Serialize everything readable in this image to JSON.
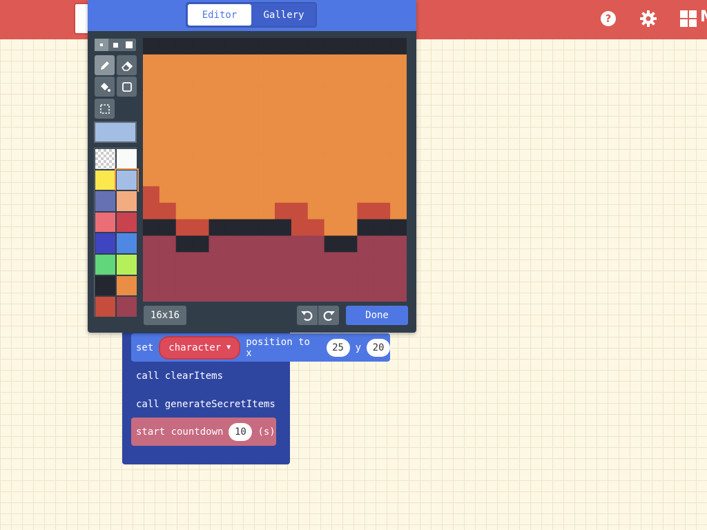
{
  "header": {
    "app_label": "M",
    "help_icon": "help-circle-icon",
    "settings_icon": "gear-icon",
    "logo_icon": "windows-logo-icon"
  },
  "editor": {
    "tabs": [
      {
        "label": "Editor",
        "active": true
      },
      {
        "label": "Gallery",
        "active": false
      }
    ],
    "brush_sizes": [
      "small",
      "medium",
      "large"
    ],
    "selected_brush": "small",
    "tools": [
      "pencil-icon",
      "eraser-icon",
      "fill-bucket-icon",
      "rectangle-icon",
      "marquee-select-icon"
    ],
    "selected_tool": "pencil-icon",
    "current_color": "#a4bde4",
    "palette": [
      "transparent",
      "#f8fbf8",
      "#fbe84f",
      "#a4bde4",
      "#6671b3",
      "#f3ab80",
      "#eb6e76",
      "#c9434f",
      "#3f44c0",
      "#4f88e3",
      "#61d67a",
      "#b5f05b",
      "#24272f",
      "#e98e44",
      "#c64c3d",
      "#9a4154"
    ],
    "canvas_size_label": "16x16",
    "done_label": "Done",
    "image_rows": [
      "MMMMMMMMMMMMMMMM",
      "OOOOOOOOOOOOOOOO",
      "OOOOOOOOOOOOOOOO",
      "OOOOOOOOOOOOOOOO",
      "OOOOOOOOOOOOOOOO",
      "OOOOOOOOOOOOOOOO",
      "OOOOOOOOOOOOOOOO",
      "OOOOOOOOOOOOOOOO",
      "OOOOOOOOOOOOOOOO",
      "ROOOOOOOOOOOOOOO",
      "RROOOOOORROOORRO",
      "MMRRMMMMMRROOMMM",
      "PPMMPPPPPPPMMPPP",
      "PPPPPPPPPPPPPPPP",
      "PPPPPPPPPPPPPPPP",
      "PPPPPPPPPPPPPPPP"
    ],
    "image_colors": {
      "M": "#24272f",
      "O": "#e98e44",
      "R": "#c64c3d",
      "P": "#9a4154"
    }
  },
  "blocks": {
    "set_keyword": "set",
    "set_variable": "character",
    "set_rest": "position to x",
    "set_x": "25",
    "set_y_label": "y",
    "set_y": "20",
    "call1_keyword": "call",
    "call1_name": "clearItems",
    "call2_keyword": "call",
    "call2_name": "generateSecretItems",
    "countdown_label": "start countdown",
    "countdown_value": "10",
    "countdown_unit": "(s)"
  }
}
